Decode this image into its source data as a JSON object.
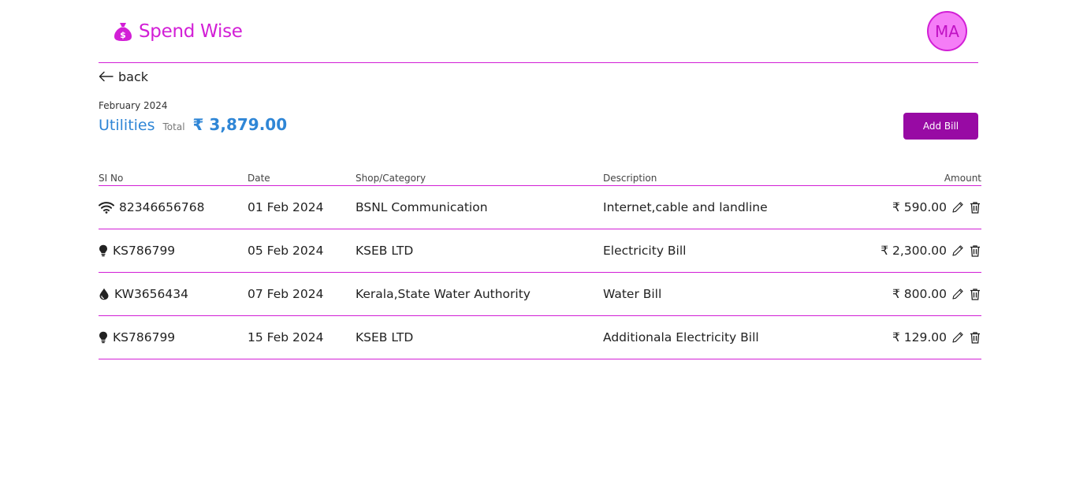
{
  "app": {
    "name": "Spend Wise",
    "brand_color": "#d21fd6",
    "accent_blue": "#2f86d6",
    "button_color": "#980aa4"
  },
  "user": {
    "initials": "MA"
  },
  "nav": {
    "back_label": "back"
  },
  "summary": {
    "period": "February 2024",
    "category": "Utilities",
    "total_label": "Total",
    "total_amount": "₹ 3,879.00"
  },
  "actions": {
    "add_bill_label": "Add Bill"
  },
  "table": {
    "headers": {
      "si_no": "SI No",
      "date": "Date",
      "shop": "Shop/Category",
      "description": "Description",
      "amount": "Amount"
    },
    "rows": [
      {
        "icon": "wifi-icon",
        "si_no": "82346656768",
        "date": "01 Feb 2024",
        "shop": "BSNL Communication",
        "description": "Internet,cable and landline",
        "amount": "₹ 590.00"
      },
      {
        "icon": "lightbulb-icon",
        "si_no": "KS786799",
        "date": "05 Feb 2024",
        "shop": "KSEB LTD",
        "description": "Electricity Bill",
        "amount": "₹ 2,300.00"
      },
      {
        "icon": "water-drop-icon",
        "si_no": "KW3656434",
        "date": "07 Feb 2024",
        "shop": "Kerala,State Water Authority",
        "description": "Water Bill",
        "amount": "₹ 800.00"
      },
      {
        "icon": "lightbulb-icon",
        "si_no": "KS786799",
        "date": "15 Feb 2024",
        "shop": "KSEB LTD",
        "description": "Additionala Electricity Bill",
        "amount": "₹ 129.00"
      }
    ],
    "row_actions": [
      "edit-icon",
      "delete-icon"
    ]
  }
}
